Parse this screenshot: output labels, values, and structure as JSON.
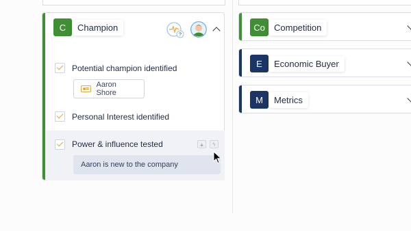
{
  "colors": {
    "champion_green": "#3f8f35",
    "navy": "#1b3566",
    "check_orange": "#e0a93a",
    "note_bg": "#dfe4ee"
  },
  "left_column": {
    "champion_card": {
      "badge": "C",
      "title": "Champion",
      "icons": [
        "activity-question-icon",
        "avatar-icon",
        "chevron-up-icon"
      ],
      "items": [
        {
          "label": "Potential champion identified",
          "checked": true,
          "contact": "Aaron Shore"
        },
        {
          "label": "Personal Interest identified",
          "checked": true
        },
        {
          "label": "Power & influence tested",
          "checked": true,
          "note": "Aaron is new to the company"
        }
      ]
    }
  },
  "right_column": {
    "cards": [
      {
        "badge": "Co",
        "title": "Competition",
        "color": "#3f8f35"
      },
      {
        "badge": "E",
        "title": "Economic Buyer",
        "color": "#1b3566"
      },
      {
        "badge": "M",
        "title": "Metrics",
        "color": "#1b3566"
      }
    ]
  }
}
